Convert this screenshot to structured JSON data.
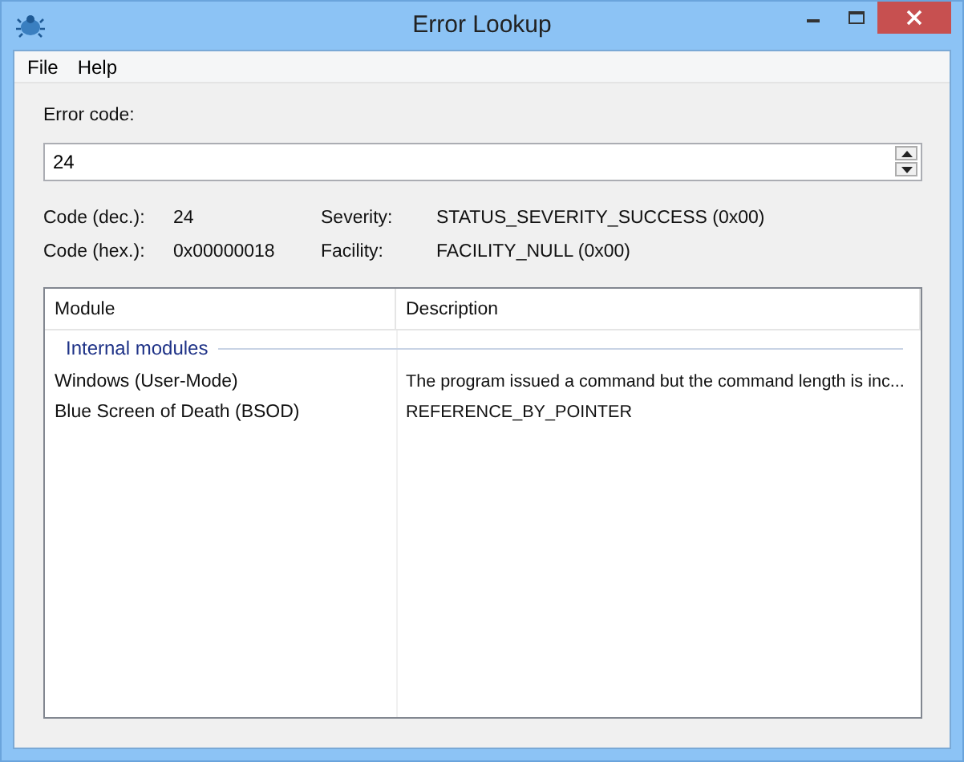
{
  "window": {
    "title": "Error Lookup"
  },
  "menu": [
    {
      "label": "File"
    },
    {
      "label": "Help"
    }
  ],
  "error_code": {
    "label": "Error code:",
    "value": "24"
  },
  "details": [
    {
      "label": "Code (dec.):",
      "value": "24"
    },
    {
      "label": "Severity:",
      "value": "STATUS_SEVERITY_SUCCESS (0x00)"
    },
    {
      "label": "Code (hex.):",
      "value": "0x00000018"
    },
    {
      "label": "Facility:",
      "value": "FACILITY_NULL (0x00)"
    }
  ],
  "table": {
    "columns": [
      "Module",
      "Description"
    ],
    "groups": [
      {
        "title": "Internal modules",
        "rows": [
          {
            "module": "Windows (User-Mode)",
            "description": "The program issued a command but the command length is inc..."
          },
          {
            "module": "Blue Screen of Death (BSOD)",
            "description": "REFERENCE_BY_POINTER"
          }
        ]
      }
    ]
  }
}
